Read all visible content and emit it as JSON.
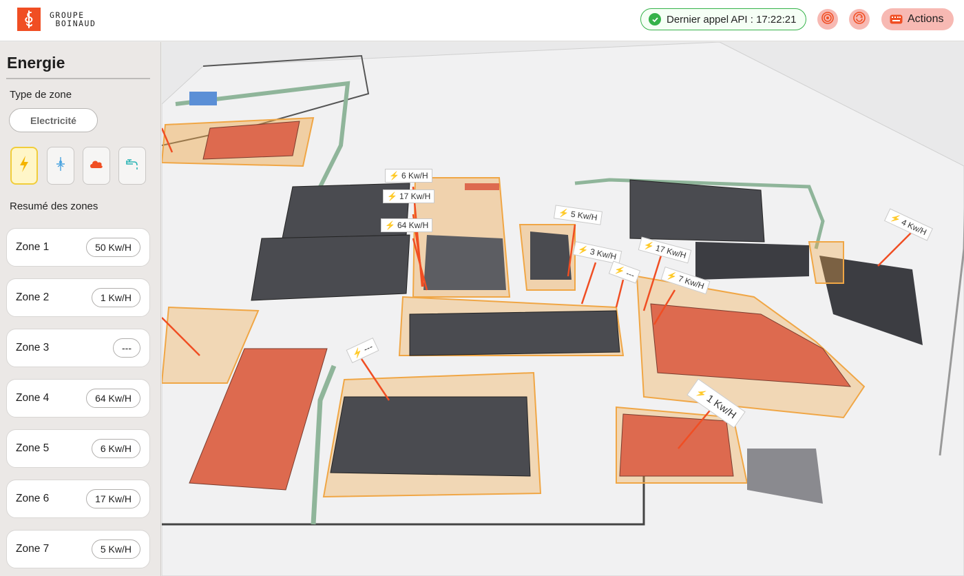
{
  "header": {
    "logo_line1": "GROUPE",
    "logo_line2": "BOINAUD",
    "api_status": "Dernier appel API : 17:22:21",
    "actions_label": "Actions"
  },
  "sidebar": {
    "title": "Energie",
    "zone_type_heading": "Type de zone",
    "zone_type_value": "Electricité",
    "type_icons": [
      "lightning-icon",
      "water-drop-icon",
      "cloud-icon",
      "tap-icon"
    ],
    "summary_heading": "Resumé des zones",
    "zones": [
      {
        "name": "Zone 1",
        "value": "50 Kw/H"
      },
      {
        "name": "Zone 2",
        "value": "1 Kw/H"
      },
      {
        "name": "Zone 3",
        "value": "---"
      },
      {
        "name": "Zone 4",
        "value": "64 Kw/H"
      },
      {
        "name": "Zone 5",
        "value": "6 Kw/H"
      },
      {
        "name": "Zone 6",
        "value": "17 Kw/H"
      },
      {
        "name": "Zone 7",
        "value": "5 Kw/H"
      }
    ]
  },
  "map": {
    "labels": [
      "6 Kw/H",
      "17 Kw/H",
      "64 Kw/H",
      "5 Kw/H",
      "3 Kw/H",
      "17 Kw/H",
      "---",
      "7 Kw/H",
      "4 Kw/H",
      "---",
      "1 Kw/H"
    ]
  },
  "colors": {
    "accent": "#f04e23",
    "ok": "#35b24a",
    "roof_red": "#dd6a4f",
    "roof_dark": "#4a4b50",
    "zone_orange": "#f0a645"
  }
}
